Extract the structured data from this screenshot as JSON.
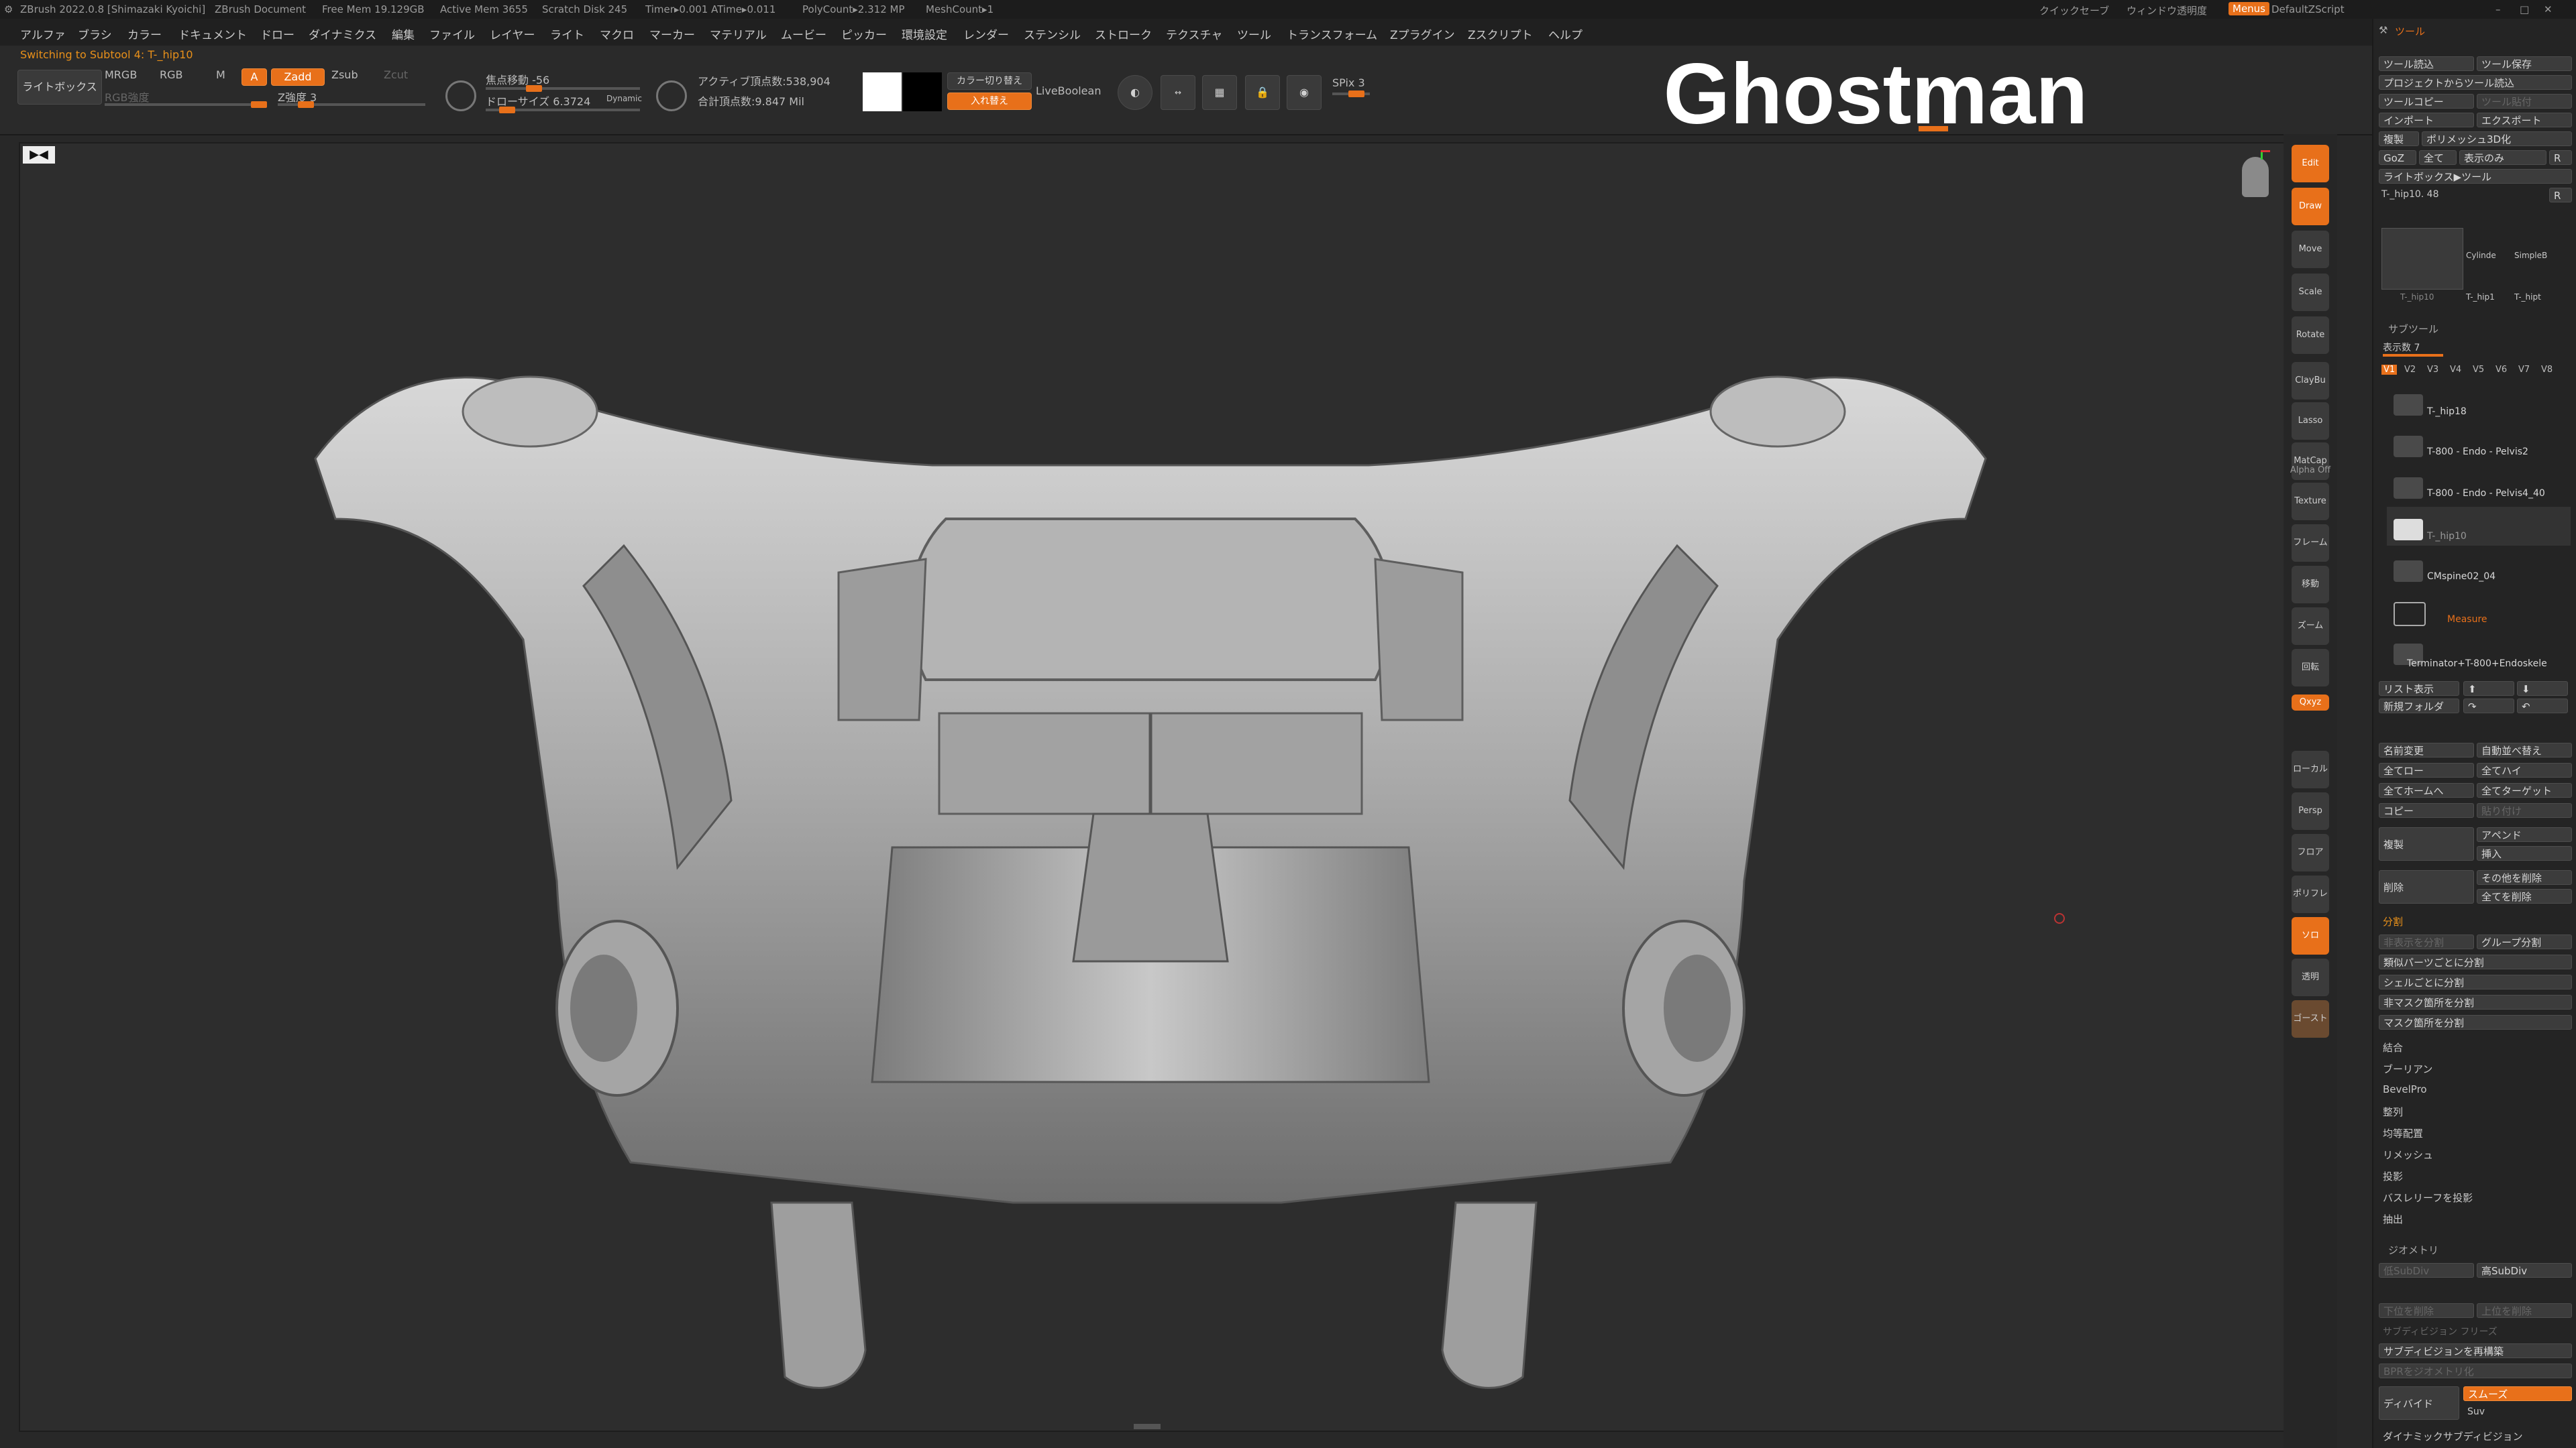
{
  "titlebar": {
    "app": "ZBrush 2022.0.8 [Shimazaki Kyoichi]",
    "doc": "ZBrush Document",
    "free_mem": "Free Mem 19.129GB",
    "active_mem": "Active Mem 3655",
    "scratch": "Scratch Disk 245",
    "timer": "Timer▸0.001 ATime▸0.011",
    "polycount": "PolyCount▸2.312 MP",
    "meshcount": "MeshCount▸1",
    "quicksave": "クイックセーブ",
    "transparency": "ウィンドウ透明度",
    "menus": "Menus",
    "script": "DefaultZScript"
  },
  "menu": [
    "アルファ",
    "ブラシ",
    "カラー",
    "ドキュメント",
    "ドロー",
    "ダイナミクス",
    "編集",
    "ファイル",
    "レイヤー",
    "ライト",
    "マクロ",
    "マーカー",
    "マテリアル",
    "ムービー",
    "ピッカー",
    "環境設定",
    "レンダー",
    "ステンシル",
    "ストローク",
    "テクスチャ",
    "ツール",
    "トランスフォーム",
    "Zプラグイン",
    "Zスクリプト",
    "ヘルプ"
  ],
  "status_line": "Switching to Subtool 4:  T-_hip10",
  "watermark": "Ghostman",
  "shelf": {
    "lightbox": "ライトボックス",
    "mrgb": "MRGB",
    "rgb": "RGB",
    "m": "M",
    "a": "A",
    "zadd": "Zadd",
    "zsub": "Zsub",
    "zcut": "Zcut",
    "rgb_intensity": "RGB強度",
    "z_intensity": "Z強度 3",
    "focal_shift": "焦点移動 -56",
    "draw_size": "ドローサイズ 6.3724",
    "dynamic": "Dynamic",
    "active_points": "アクティブ頂点数:538,904",
    "total_points": "合計頂点数:9.847 Mil",
    "switch_color": "カラー切り替え",
    "swap": "入れ替え",
    "livebool": "LiveBoolean",
    "spix": "SPix 3"
  },
  "right_strip": [
    "Edit",
    "Draw",
    "Move",
    "Scale",
    "Rotate",
    "ClayBu",
    "Lasso",
    "MatCap",
    "Alpha Off",
    "Texture Off",
    "フレーム",
    "移動",
    "ズーム",
    "回転",
    "Qxyz",
    "ローカル",
    "Persp",
    "フロア",
    "ポリフレーム",
    "ソロ",
    "透明",
    "ゴースト"
  ],
  "panel": {
    "tool_title": "ツール",
    "load_tool": "ツール読込",
    "save_tool": "ツール保存",
    "load_from_project": "プロジェクトからツール読込",
    "copy_tool": "ツールコピー",
    "paste_tool": "ツール貼付",
    "import": "インポート",
    "export": "エクスポート",
    "clone": "複製",
    "polymesh3d": "ポリメッシュ3D化",
    "goz": "GoZ",
    "all": "全て",
    "visible": "表示のみ",
    "r": "R",
    "lightbox_tool": "ライトボックス▶ツール",
    "current_tool": "T-_hip10. 48",
    "thumb_labels": [
      "T-_hip10",
      "Cylinde",
      "SimpleB",
      "T-_hip1",
      "T-_hipt"
    ],
    "subtool_head": "サブツール",
    "visible_count": "表示数 7",
    "versions": [
      "V1",
      "V2",
      "V3",
      "V4",
      "V5",
      "V6",
      "V7",
      "V8"
    ],
    "subtools": [
      "T-_hip18",
      "T-800 - Endo - Pelvis2",
      "T-800 - Endo - Pelvis4_40",
      "T-_hip10",
      "CMspine02_04",
      "Measure",
      "Terminator+T-800+Endoskele"
    ],
    "list_view": "リスト表示",
    "new_folder": "新規フォルダ",
    "rename": "名前変更",
    "auto_reorder": "自動並べ替え",
    "all_low": "全てロー",
    "all_high": "全てハイ",
    "all_to_home": "全てホームへ",
    "all_to_target": "全てターゲット",
    "copy": "コピー",
    "paste": "貼り付け",
    "duplicate": "複製",
    "append": "アペンド",
    "insert": "挿入",
    "delete": "削除",
    "del_other": "その他を削除",
    "del_all": "全てを削除",
    "split_head": "分割",
    "split_hidden": "非表示を分割",
    "group_split": "グループ分割",
    "split_similar": "類似パーツごとに分割",
    "split_shell": "シェルごとに分割",
    "split_unmasked": "非マスク箇所を分割",
    "split_masked": "マスク箇所を分割",
    "merge": "結合",
    "boolean": "ブーリアン",
    "bevelpro": "BevelPro",
    "align": "整列",
    "distribute": "均等配置",
    "remesh": "リメッシュ",
    "project": "投影",
    "project_bas": "バスレリーフを投影",
    "extract": "抽出",
    "geometry_head": "ジオメトリ",
    "lower_res": "低SubDiv",
    "higher_res": "高SubDiv",
    "del_lower": "下位を削除",
    "del_higher": "上位を削除",
    "freeze_subdiv": "サブディビジョン フリーズ",
    "reconstruct": "サブディビジョンを再構築",
    "convert_bpr": "BPRをジオメトリ化",
    "divide": "ディバイド",
    "smooth": "スムーズ",
    "suv": "Suv",
    "dyn_subdiv": "ダイナミックサブディビジョン"
  },
  "colors": {
    "accent": "#e8701a",
    "bg": "#282828",
    "viewport": "#2d2d2d",
    "panel": "#242424"
  }
}
